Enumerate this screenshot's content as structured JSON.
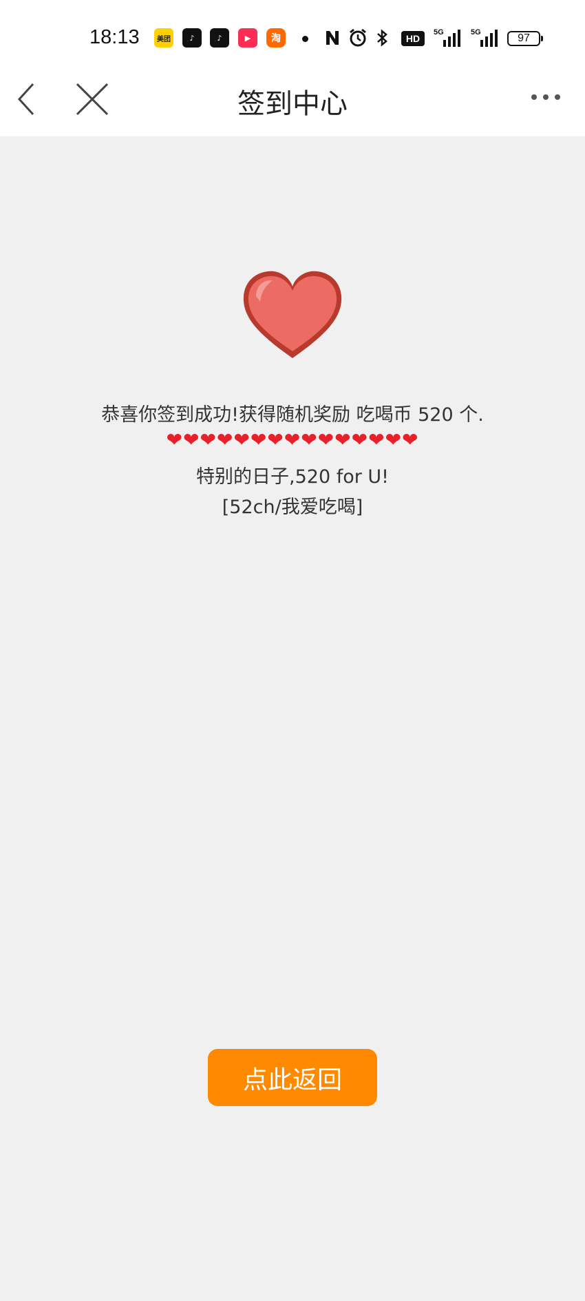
{
  "status_bar": {
    "time": "18:13",
    "apps": [
      {
        "name": "meituan-icon",
        "label": "美团"
      },
      {
        "name": "douyin-icon",
        "label": "♪"
      },
      {
        "name": "douyin-icon",
        "label": "♪"
      },
      {
        "name": "video-icon",
        "label": "▶"
      },
      {
        "name": "taobao-icon",
        "label": "淘"
      }
    ],
    "network": "HD",
    "signal_label_1": "5G",
    "signal_label_2": "5G",
    "battery": "97"
  },
  "nav": {
    "title": "签到中心"
  },
  "content": {
    "line1": "恭喜你签到成功!获得随机奖励 吃喝币 520 个.",
    "hearts": "❤❤❤❤❤❤❤❤❤❤❤❤❤❤❤",
    "line3": "特别的日子,520 for U!",
    "line4": "[52ch/我爱吃喝]"
  },
  "return_button": {
    "label": "点此返回"
  },
  "colors": {
    "background": "#f0f0f0",
    "button": "#ff8a00",
    "heart": "#e8202a"
  }
}
